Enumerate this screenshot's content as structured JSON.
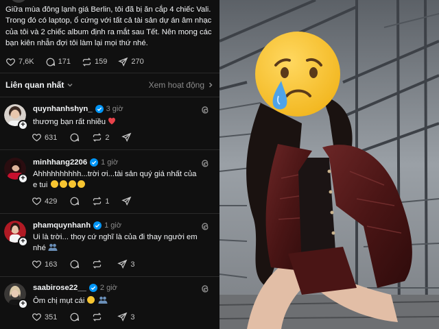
{
  "post": {
    "text": "Giữa mùa đông lạnh giá Berlin, tôi đã bị ăn cắp 4 chiếc Vali. Trong đó có laptop, ổ cứng với tất cả tài sản dự án âm nhạc của tôi và 2 chiếc album định ra mắt sau Tết. Nên mong các bạn kiên nhẫn đợi tôi làm lại mọi thứ nhé.",
    "likes": "7,6K",
    "comments": "171",
    "reposts": "159",
    "shares": "270"
  },
  "sort": {
    "label": "Liên quan nhất",
    "activity_link": "Xem hoạt động"
  },
  "comments": [
    {
      "username": "quynhanhshyn_",
      "time": "3 giờ",
      "text": "thương bạn rất nhiều",
      "emoji_icon": "red-heart",
      "likes": "631",
      "reposts": "2",
      "shares": ""
    },
    {
      "username": "minhhang2206",
      "time": "1 giờ",
      "text_line1": "Ahhhhhhhhhh...trời ơi...tài sản quý giá nhất của",
      "text_line2": "e tui",
      "emoji_icon": "sad-face-x4",
      "likes": "429",
      "reposts": "1",
      "shares": ""
    },
    {
      "username": "phamquynhanh",
      "time": "1 giờ",
      "text_line1": "Ui là trời... thoy cứ nghĩ là của đi thay người em",
      "text_line2": "nhé",
      "emoji_icon": "people-hugging",
      "likes": "163",
      "reposts": "",
      "shares": "3"
    },
    {
      "username": "saabirose22__",
      "time": "2 giờ",
      "text": "Ôm chị mụt cái",
      "emoji_icon": "sad-face-and-people-hugging",
      "likes": "351",
      "reposts": "",
      "shares": "3"
    }
  ],
  "colors": {
    "background": "#101010",
    "text": "#f3f5f7",
    "muted": "#8a8a8a",
    "verified": "#0095f6",
    "heart": "#e8424a"
  },
  "icons": [
    "heart-icon",
    "comment-icon",
    "repost-icon",
    "share-icon",
    "verified-icon",
    "threads-icon",
    "chevron-down-icon",
    "chevron-right-icon",
    "crying-emoji"
  ]
}
